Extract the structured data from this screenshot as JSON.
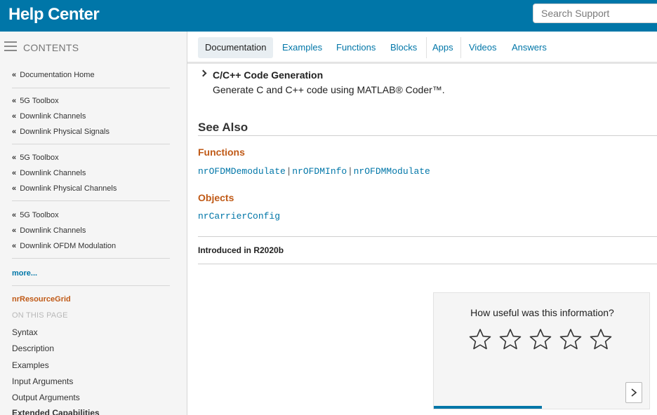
{
  "header": {
    "title": "Help Center",
    "search_placeholder": "Search Support"
  },
  "sidebar": {
    "contents_label": "CONTENTS",
    "breadcrumbs": [
      {
        "label": "Documentation Home"
      },
      {
        "label": "5G Toolbox"
      },
      {
        "label": "Downlink Channels"
      },
      {
        "label": "Downlink Physical Signals"
      },
      {
        "label": "5G Toolbox"
      },
      {
        "label": "Downlink Channels"
      },
      {
        "label": "Downlink Physical Channels"
      },
      {
        "label": "5G Toolbox"
      },
      {
        "label": "Downlink Channels"
      },
      {
        "label": "Downlink OFDM Modulation"
      }
    ],
    "chevron": "«",
    "more_label": "more...",
    "current_page": "nrResourceGrid",
    "on_this_page_label": "ON THIS PAGE",
    "toc": [
      {
        "label": "Syntax"
      },
      {
        "label": "Description"
      },
      {
        "label": "Examples"
      },
      {
        "label": "Input Arguments"
      },
      {
        "label": "Output Arguments"
      },
      {
        "label": "Extended Capabilities"
      }
    ]
  },
  "tabs": [
    {
      "label": "Documentation",
      "active": true
    },
    {
      "label": "Examples"
    },
    {
      "label": "Functions"
    },
    {
      "label": "Blocks"
    },
    {
      "label": "Apps"
    },
    {
      "label": "Videos"
    },
    {
      "label": "Answers"
    }
  ],
  "main": {
    "section_title": "C/C++ Code Generation",
    "section_desc": "Generate C and C++ code using MATLAB® Coder™.",
    "see_also": "See Also",
    "functions_heading": "Functions",
    "functions": [
      "nrOFDMDemodulate",
      "nrOFDMInfo",
      "nrOFDMModulate"
    ],
    "separator": "|",
    "objects_heading": "Objects",
    "objects": [
      "nrCarrierConfig"
    ],
    "introduced": "Introduced in R2020b"
  },
  "feedback": {
    "question": "How useful was this information?",
    "stars_total": 5,
    "rating": 0,
    "progress_fraction": 0.5
  },
  "colors": {
    "brand_blue": "#0076a8",
    "accent_orange": "#c05a17"
  }
}
